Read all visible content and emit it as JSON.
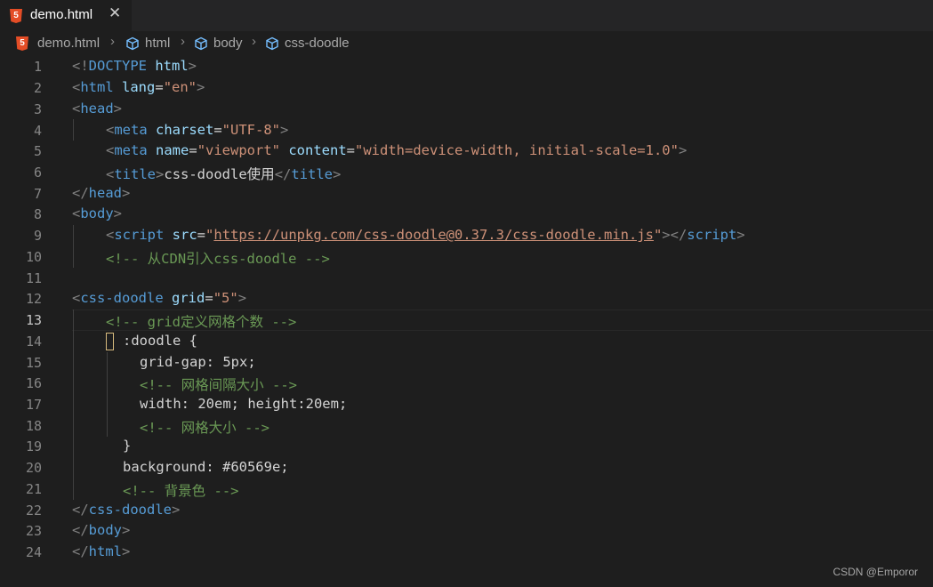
{
  "tab": {
    "label": "demo.html",
    "close": "✕"
  },
  "breadcrumb": {
    "file": "demo.html",
    "items": [
      "html",
      "body",
      "css-doodle"
    ]
  },
  "editor": {
    "active_line": 13,
    "line_numbers": [
      "1",
      "2",
      "3",
      "4",
      "5",
      "6",
      "7",
      "8",
      "9",
      "10",
      "11",
      "12",
      "13",
      "14",
      "15",
      "16",
      "17",
      "18",
      "19",
      "20",
      "21",
      "22",
      "23",
      "24"
    ],
    "lines": [
      {
        "t1": "<!",
        "tag1": "DOCTYPE",
        "attr1": " html",
        "t2": ">"
      },
      {
        "t1": "<",
        "tag1": "html",
        "attr1": " lang",
        "t2": "=",
        "str1": "\"en\"",
        "t3": ">"
      },
      {
        "t1": "<",
        "tag1": "head",
        "t2": ">"
      },
      {
        "t1": "<",
        "tag1": "meta",
        "attr1": " charset",
        "t2": "=",
        "str1": "\"UTF-8\"",
        "t3": ">"
      },
      {
        "t1": "<",
        "tag1": "meta",
        "attr1": " name",
        "t2": "=",
        "str1": "\"viewport\"",
        "attr2": " content",
        "t3": "=",
        "str2": "\"width=device-width, initial-scale=1.0\"",
        "t4": ">"
      },
      {
        "t1": "<",
        "tag1": "title",
        "t2": ">",
        "text1": "css-doodle使用",
        "t3": "</",
        "tag2": "title",
        "t4": ">"
      },
      {
        "t1": "</",
        "tag1": "head",
        "t2": ">"
      },
      {
        "t1": "<",
        "tag1": "body",
        "t2": ">"
      },
      {
        "t1": "<",
        "tag1": "script",
        "attr1": " src",
        "t2": "=",
        "str1": "\"",
        "url1": "https://unpkg.com/css-doodle@0.37.3/css-doodle.min.js",
        "str2": "\"",
        "t3": "></",
        "tag2": "script",
        "t4": ">"
      },
      {
        "cmt1": "<!-- 从CDN引入css-doodle -->"
      },
      {},
      {
        "t1": "<",
        "tag1": "css-doodle",
        "attr1": " grid",
        "t2": "=",
        "str1": "\"5\"",
        "t3": ">"
      },
      {
        "cmt1": "<!-- grid定义网格个数 -->"
      },
      {
        "sel1": ":doodle",
        "text1": " {"
      },
      {
        "prop1": "grid-gap: 5px;"
      },
      {
        "cmt1": "<!-- 网格间隔大小 -->"
      },
      {
        "prop1": "width: 20em; height:20em;"
      },
      {
        "cmt1": "<!-- 网格大小 -->"
      },
      {
        "prop1": "}"
      },
      {
        "prop1": "background: #60569e;"
      },
      {
        "cmt1": "<!-- 背景色 -->"
      },
      {
        "t1": "</",
        "tag1": "css-doodle",
        "t2": ">"
      },
      {
        "t1": "</",
        "tag1": "body",
        "t2": ">"
      },
      {
        "t1": "</",
        "tag1": "html",
        "t2": ">"
      }
    ]
  },
  "watermark": "CSDN @Emporor",
  "colors": {
    "background": "#1e1e1e",
    "tag": "#569cd6",
    "attribute": "#9cdcfe",
    "string": "#ce9178",
    "comment": "#6a9955",
    "html5_icon": "#e44d26"
  }
}
